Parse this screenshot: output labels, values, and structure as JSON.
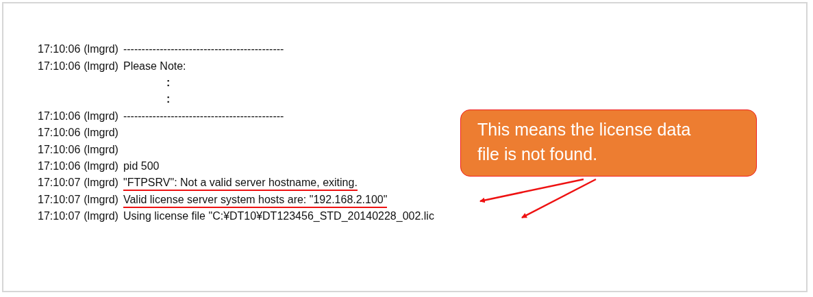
{
  "log_lines": [
    {
      "kind": "entry",
      "time": "17:10:06",
      "source": "(lmgrd)",
      "message": "--------------------------------------------",
      "highlighted": false
    },
    {
      "kind": "entry",
      "time": "17:10:06",
      "source": "(lmgrd)",
      "message": "Please Note:",
      "highlighted": false
    },
    {
      "kind": "continuation",
      "message": ":"
    },
    {
      "kind": "continuation",
      "message": ":"
    },
    {
      "kind": "entry",
      "time": "17:10:06",
      "source": "(lmgrd)",
      "message": "--------------------------------------------",
      "highlighted": false
    },
    {
      "kind": "entry",
      "time": "17:10:06",
      "source": "(lmgrd)"
    },
    {
      "kind": "entry",
      "time": "17:10:06",
      "source": "(lmgrd)"
    },
    {
      "kind": "entry",
      "time": "17:10:06",
      "source": "(lmgrd)",
      "message": "pid 500",
      "highlighted": false
    },
    {
      "kind": "entry",
      "time": "17:10:07",
      "source": "(lmgrd)",
      "message": "\"FTPSRV\": Not a valid server hostname, exiting.",
      "highlighted": true
    },
    {
      "kind": "entry",
      "time": "17:10:07",
      "source": "(lmgrd)",
      "message": "Valid license server system hosts are: \"192.168.2.100\"",
      "highlighted": true
    },
    {
      "kind": "entry",
      "time": "17:10:07",
      "source": "(lmgrd)",
      "message": "Using license file \"C:¥DT10¥DT123456_STD_20140228_002.lic",
      "highlighted": false
    }
  ],
  "callout": {
    "text": "This means the license data file is not found."
  }
}
